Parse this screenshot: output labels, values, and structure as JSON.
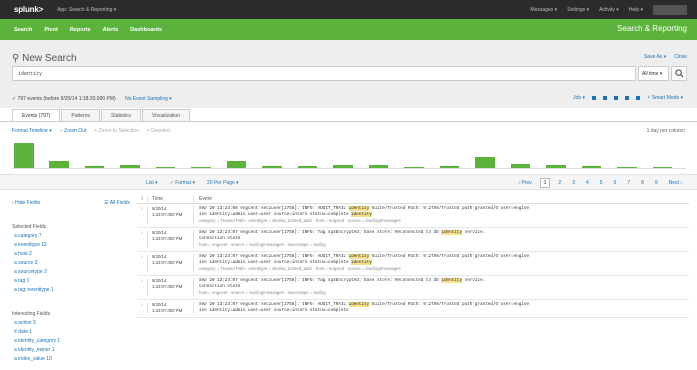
{
  "topbar": {
    "logo": "splunk>",
    "app": "App: Search & Reporting ▾",
    "links": [
      "Messages ▾",
      "Settings ▾",
      "Activity ▾",
      "Help ▾"
    ],
    "find_placeholder": "Find"
  },
  "appbar": {
    "nav": [
      "Search",
      "Pivot",
      "Reports",
      "Alerts",
      "Dashboards"
    ],
    "app_title": "Search & Reporting"
  },
  "header": {
    "title": "New Search",
    "save_as": "Save As ▾",
    "close": "Close",
    "query": "identity",
    "time_range": "All time ▾",
    "status_text": "✓ 797 events (before 9/20/14 1:18:20.000 PM)",
    "sampling": "No Event Sampling ▾",
    "job": "Job ▾",
    "smart_mode": "⚡ Smart Mode ▾"
  },
  "tabs": [
    "Events (797)",
    "Patterns",
    "Statistics",
    "Visualization"
  ],
  "timeline": {
    "format": "Format Timeline ▾",
    "zoom_out": "− Zoom Out",
    "zoom_selection": "+ Zoom to Selection",
    "deselect": "× Deselect",
    "per_column": "1 day per column",
    "bars": [
      0.88,
      0.25,
      0.08,
      0.12,
      0.05,
      0.03,
      0.25,
      0.06,
      0.06,
      0.12,
      0.1,
      0.05,
      0.08,
      0.4,
      0.15,
      0.12,
      0.08,
      0.05,
      0.05
    ]
  },
  "pager": {
    "list": "List ▾",
    "format": "✓ Format ▾",
    "per_page": "20 Per Page ▾",
    "prev": "‹ Prev",
    "pages": [
      "1",
      "2",
      "3",
      "4",
      "5",
      "6",
      "7",
      "8",
      "9"
    ],
    "next": "Next ›"
  },
  "sidebar": {
    "hide_fields": "‹ Hide Fields",
    "all_fields": "☰ All Fields",
    "selected_header": "Selected Fields",
    "selected": [
      "a category 7",
      "a eventtype 12",
      "a host 2",
      "a source 3",
      "a sourcetype 3",
      "a tag 1",
      "a tag::eventtype 1"
    ],
    "interesting_header": "Interesting Fields",
    "interesting": [
      "a action 3",
      "# date 1",
      "a identity_category 1",
      "a identity_owner 1",
      "a index_value 10"
    ]
  },
  "results": {
    "col_info": "i",
    "col_time": "Time",
    "col_event": "Event",
    "rows": [
      {
        "date": "9/20/14",
        "time": "1:23:07.000 PM",
        "pre": "Sep 20 13:23:08 engcent sec1user[2758]: INFO: AUDIT_TRAIL",
        "hl1": "identity",
        "mid": " Suite/Trusted Path: 0.2766/Trusted path granted/O user=engine",
        "line2": "ise identity=admin user=user source=intern status=complete",
        "hl2": "identity",
        "fields": "category = Trusted Path · eventtype = identity_trusted_path · host = engcent · source = /var/log/messages"
      },
      {
        "date": "9/20/14",
        "time": "1:23:07.000 PM",
        "pre": "Sep 20 13:23:07 engcent sec1user[2758]: INFO: Tag sq4Encrypted: base store: Reconnected to db",
        "hl1": "identity",
        "mid": " service.",
        "line2": "connection state",
        "hl2": "",
        "fields": "host = engcent · source = /var/log/messages · sourcetype = syslog"
      },
      {
        "date": "9/20/14",
        "time": "1:23:07.000 PM",
        "pre": "Sep 20 13:23:07 engcent sec1user[2758]: INFO: AUDIT_TRAIL",
        "hl1": "identity",
        "mid": " Suite/Trusted Path: 0.2766/Trusted path granted/O user=engine",
        "line2": "ise identity=admin user=user source=intern status=complete",
        "hl2": "identity",
        "fields": "category = Trusted Path · eventtype = identity_trusted_path · host = engcent · source = /var/log/messages"
      },
      {
        "date": "9/20/14",
        "time": "1:23:07.000 PM",
        "pre": "Sep 20 13:23:07 engcent sec1user[2758]: INFO: Tag sq4Encrypted: base store: Reconnected to db",
        "hl1": "identity",
        "mid": " service.",
        "line2": "connection state",
        "hl2": "",
        "fields": "host = engcent · source = /var/log/messages · sourcetype = syslog"
      },
      {
        "date": "9/20/14",
        "time": "1:23:07.000 PM",
        "pre": "Sep 20 13:23:07 engcent sec1user[2758]: INFO: AUDIT_TRAIL",
        "hl1": "identity",
        "mid": " Suite/Trusted Path: 0.2766/Trusted path granted/O user=engine",
        "line2": "ise identity=admin user=user source=intern status=complete",
        "hl2": "",
        "fields": ""
      }
    ]
  },
  "colors": {
    "app_green": "#5cb33b",
    "topbar": "#2b2b2b",
    "link": "#1a73b8",
    "highlight": "#f6e08a"
  }
}
